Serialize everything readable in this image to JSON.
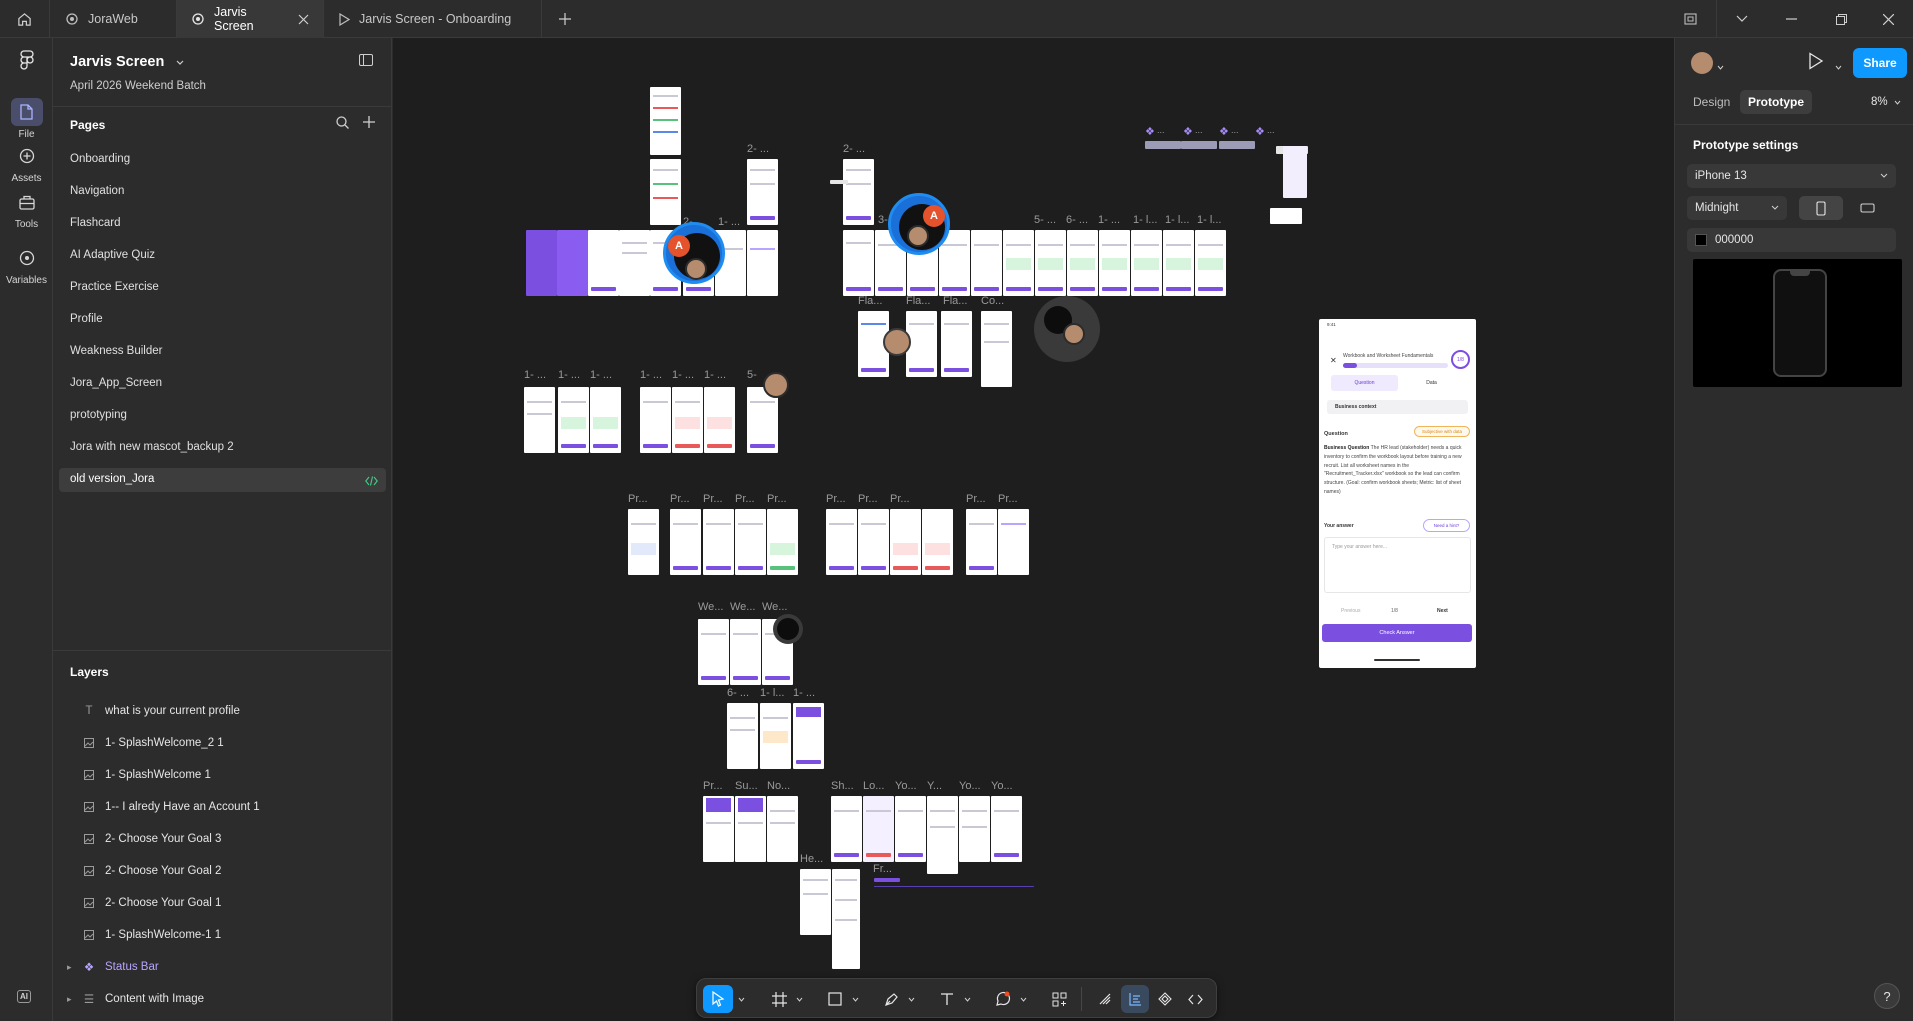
{
  "tabs": [
    {
      "label": "JoraWeb"
    },
    {
      "label": "Jarvis Screen"
    },
    {
      "label": "Jarvis Screen - Onboarding"
    }
  ],
  "rail": [
    {
      "label": "File",
      "icon": "file-icon"
    },
    {
      "label": "Assets",
      "icon": "assets-icon"
    },
    {
      "label": "Tools",
      "icon": "tools-icon"
    },
    {
      "label": "Variables",
      "icon": "variables-icon"
    }
  ],
  "file": {
    "title": "Jarvis Screen",
    "subtitle": "April 2026 Weekend Batch"
  },
  "pages": {
    "heading": "Pages",
    "items": [
      "Onboarding",
      "Navigation",
      "Flashcard",
      "AI Adaptive Quiz",
      "Practice Exercise",
      "Profile",
      "Weakness Builder",
      "Jora_App_Screen",
      "prototyping",
      "Jora with new mascot_backup 2",
      "old version_Jora"
    ],
    "selected": "old version_Jora"
  },
  "layers": {
    "heading": "Layers",
    "items": [
      {
        "label": "what is your current profile",
        "icon": "text-icon"
      },
      {
        "label": "1- SplashWelcome_2 1",
        "icon": "image-icon"
      },
      {
        "label": "1- SplashWelcome 1",
        "icon": "image-icon"
      },
      {
        "label": "1-- I alredy Have an Account 1",
        "icon": "image-icon"
      },
      {
        "label": "2- Choose Your Goal 3",
        "icon": "image-icon"
      },
      {
        "label": "2- Choose Your Goal 2",
        "icon": "image-icon"
      },
      {
        "label": "2- Choose Your Goal 1",
        "icon": "image-icon"
      },
      {
        "label": "1- SplashWelcome-1 1",
        "icon": "image-icon"
      },
      {
        "label": "Status Bar",
        "icon": "component-icon"
      },
      {
        "label": "Content with Image",
        "icon": "frame-icon"
      }
    ]
  },
  "ai_badge": "AI",
  "canvas": {
    "labels": {
      "l1": "2- ...",
      "l2": "2- ...",
      "l3": "2-",
      "l4": "1- ...",
      "l5": "3-",
      "l6": "5- ...",
      "l7": "6- ...",
      "l8": "1- ...",
      "l9": "1- l...",
      "l10": "1- l...",
      "l11": "1- l...",
      "l12": "Fla...",
      "l13": "Fla...",
      "l14": "Fla...",
      "l15": "Co...",
      "l16": "1- ...",
      "l17": "1- ...",
      "l18": "1- ...",
      "l19": "1- ...",
      "l20": "1- ...",
      "l21": "1- ...",
      "l22": "5-",
      "l23": "Pr...",
      "l24": "Pr...",
      "l25": "Pr...",
      "l26": "Pr...",
      "l27": "Pr...",
      "l28": "Pr...",
      "l29": "Pr...",
      "l30": "Pr...",
      "l31": "Pr...",
      "l32": "Pr...",
      "l33": "We...",
      "l34": "We...",
      "l35": "We...",
      "l36": "6- ...",
      "l37": "1- l...",
      "l38": "1- ...",
      "l39": "Pr...",
      "l40": "Su...",
      "l41": "No...",
      "l42": "Sh...",
      "l43": "Lo...",
      "l44": "Yo...",
      "l45": "Y...",
      "l46": "Yo...",
      "l47": "Yo...",
      "l48": "He...",
      "l49": "Fr...",
      "c1": "...",
      "c2": "...",
      "c3": "...",
      "c4": "..."
    },
    "badge_letter": "A",
    "preview": {
      "status_time": "9:41",
      "title": "Workbook and Worksheet Fundamentals",
      "progress_fraction": 0.13,
      "counter": "1/8",
      "tab_question": "Question",
      "tab_data": "Data",
      "context": "Business context",
      "question_heading": "Question",
      "tag": "Subjective with data",
      "question_lead": "Business Question",
      "question_body": "The HR lead (stakeholder) needs a quick inventory to confirm the workbook layout before training a new recruit. List all worksheet names in the \"Recruitment_Tracker.xlsx\" workbook so the lead can confirm structure. (Goal: confirm workbook sheets; Metric: list of sheet names)",
      "answer_heading": "Your answer",
      "hint": "Need a hint?",
      "placeholder": "Type your answer here...",
      "prev": "Previous",
      "page": "1/8",
      "next": "Next",
      "check": "Check Answer"
    }
  },
  "toolbar": {
    "items": [
      "move-tool",
      "frame-tool",
      "shape-tool",
      "pen-tool",
      "text-tool",
      "comment-tool",
      "actions-tool",
      "draw-mode",
      "design-mode",
      "prototype-mode",
      "dev-mode"
    ],
    "active": "move-tool"
  },
  "right": {
    "share": "Share",
    "tab_design": "Design",
    "tab_prototype": "Prototype",
    "zoom": "8%",
    "heading": "Prototype settings",
    "device": "iPhone 13",
    "model": "Midnight",
    "bg_hex": "000000",
    "help": "?"
  }
}
